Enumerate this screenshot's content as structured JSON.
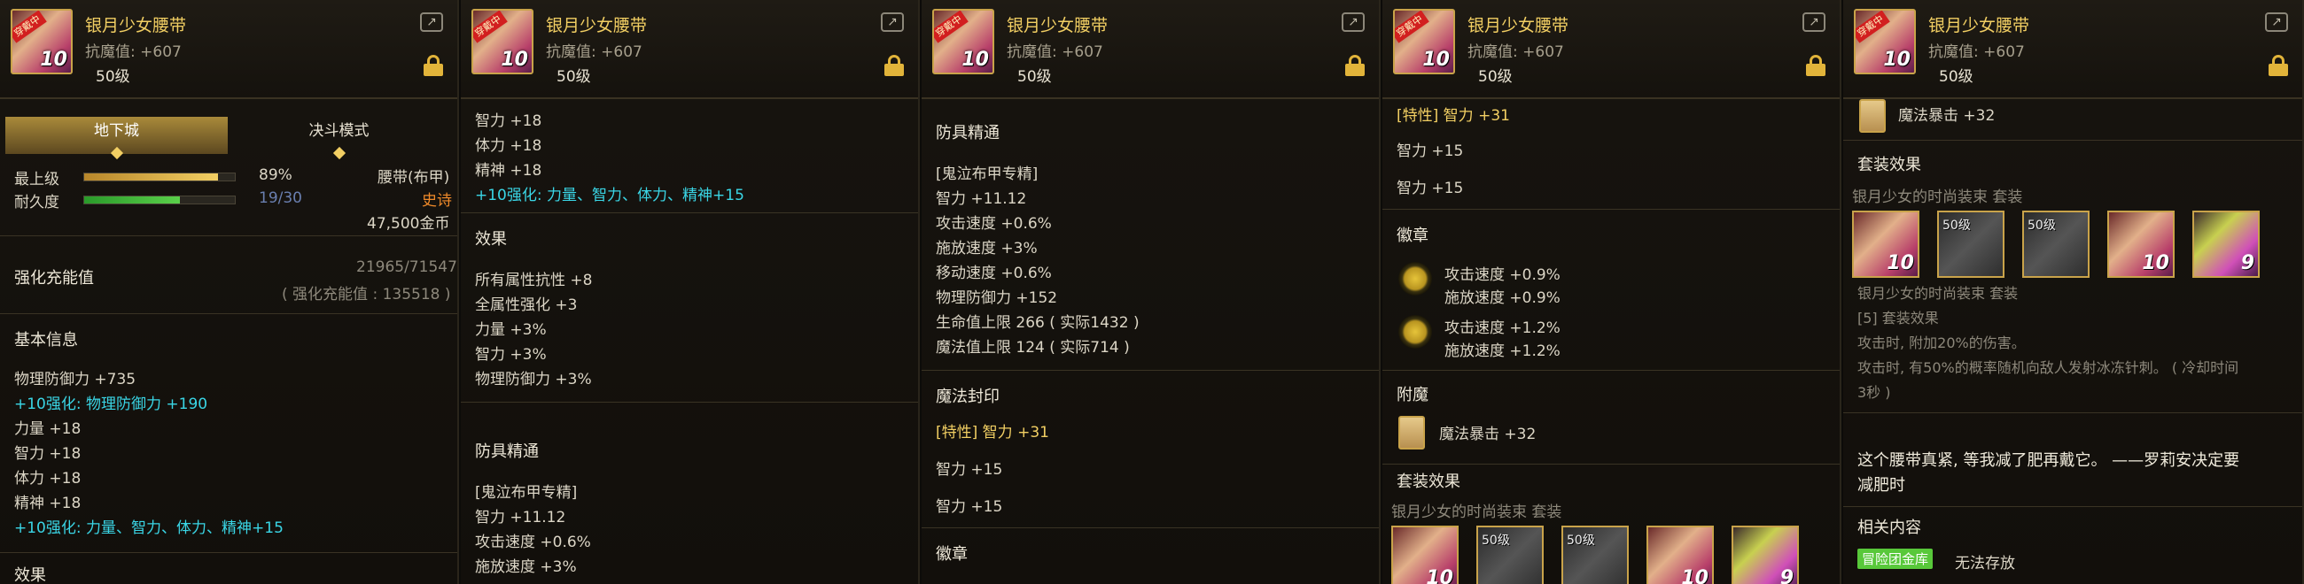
{
  "header": {
    "name": "银月少女腰带",
    "resist": "抗魔值: +607",
    "level": "50级",
    "badge": "穿戴中",
    "enhance": "10"
  },
  "panel1": {
    "tab_active": "地下城",
    "tab_inactive": "决斗模式",
    "max_label": "最上级",
    "max_value": "89%",
    "max_fraction": 0.89,
    "dur_label": "耐久度",
    "dur_value": "19/30",
    "dur_fraction": 0.633,
    "type": "腰带(布甲)",
    "rarity": "史诗",
    "price": "47,500金币",
    "charge_label": "强化充能值",
    "charge_value": "21965/71547",
    "charge_sub": "( 强化充能值 : 135518 )",
    "basic_title": "基本信息",
    "lines": [
      "物理防御力 +735",
      "+10强化: 物理防御力 +190",
      "力量 +18",
      "智力 +18",
      "体力 +18",
      "精神 +18",
      "+10强化: 力量、智力、体力、精神+15"
    ],
    "cut": "效果"
  },
  "panel2": {
    "top": [
      "智力 +18",
      "体力 +18",
      "精神 +18",
      "+10强化: 力量、智力、体力、精神+15"
    ],
    "effect_title": "效果",
    "effects": [
      "所有属性抗性 +8",
      "全属性强化 +3",
      "力量 +3%",
      "智力 +3%",
      "物理防御力 +3%"
    ],
    "mastery_title": "防具精通",
    "mastery": [
      "[鬼泣布甲专精]",
      "智力 +11.12",
      "攻击速度 +0.6%",
      "施放速度 +3%"
    ]
  },
  "panel3": {
    "mastery_title": "防具精通",
    "mastery": [
      "[鬼泣布甲专精]",
      "智力 +11.12",
      "攻击速度 +0.6%",
      "施放速度 +3%",
      "移动速度 +0.6%",
      "物理防御力 +152",
      "生命值上限 266 ( 实际1432 )",
      "魔法值上限 124 ( 实际714 )"
    ],
    "seal_title": "魔法封印",
    "seal": [
      "[特性] 智力 +31",
      "智力 +15",
      "智力 +15"
    ],
    "emblem_title": "徽章"
  },
  "panel4": {
    "seal": [
      "[特性] 智力 +31",
      "智力 +15",
      "智力 +15"
    ],
    "emblem_title": "徽章",
    "emblem1": [
      "攻击速度 +0.9%",
      "施放速度 +0.9%"
    ],
    "emblem2": [
      "攻击速度 +1.2%",
      "施放速度 +1.2%"
    ],
    "enchant_title": "附魔",
    "enchant": "魔法暴击 +32",
    "set_title": "套装效果",
    "set_name": "银月少女的时尚装束 套装",
    "set_items": [
      {
        "lv": "",
        "n": "10",
        "kind": "belt"
      },
      {
        "lv": "50级",
        "n": "",
        "kind": "gray"
      },
      {
        "lv": "50级",
        "n": "",
        "kind": "gray"
      },
      {
        "lv": "",
        "n": "10",
        "kind": "belt"
      },
      {
        "lv": "",
        "n": "9",
        "kind": "shoe"
      }
    ]
  },
  "panel5": {
    "enchant": "魔法暴击 +32",
    "set_title": "套装效果",
    "set_name": "银月少女的时尚装束 套装",
    "set_items": [
      {
        "lv": "",
        "n": "10",
        "kind": "belt"
      },
      {
        "lv": "50级",
        "n": "",
        "kind": "gray"
      },
      {
        "lv": "50级",
        "n": "",
        "kind": "gray"
      },
      {
        "lv": "",
        "n": "10",
        "kind": "belt"
      },
      {
        "lv": "",
        "n": "9",
        "kind": "shoe"
      }
    ],
    "set_sub": "银月少女的时尚装束 套装",
    "set_lines": [
      "[5] 套装效果",
      "攻击时, 附加20%的伤害。",
      "攻击时, 有50%的概率随机向敌人发射冰冻针刺。 ( 冷却时间",
      "3秒 )"
    ],
    "flavor1": "这个腰带真紧, 等我减了肥再戴它。 ——罗莉安决定要",
    "flavor2": "减肥时",
    "related_title": "相关内容",
    "related_badge": "冒险团金库",
    "related_text": "无法存放"
  },
  "colors": {
    "gold": "#f2cf63",
    "cyan": "#3ad6e6",
    "orange": "#f08a2a",
    "green": "#58c83a"
  }
}
